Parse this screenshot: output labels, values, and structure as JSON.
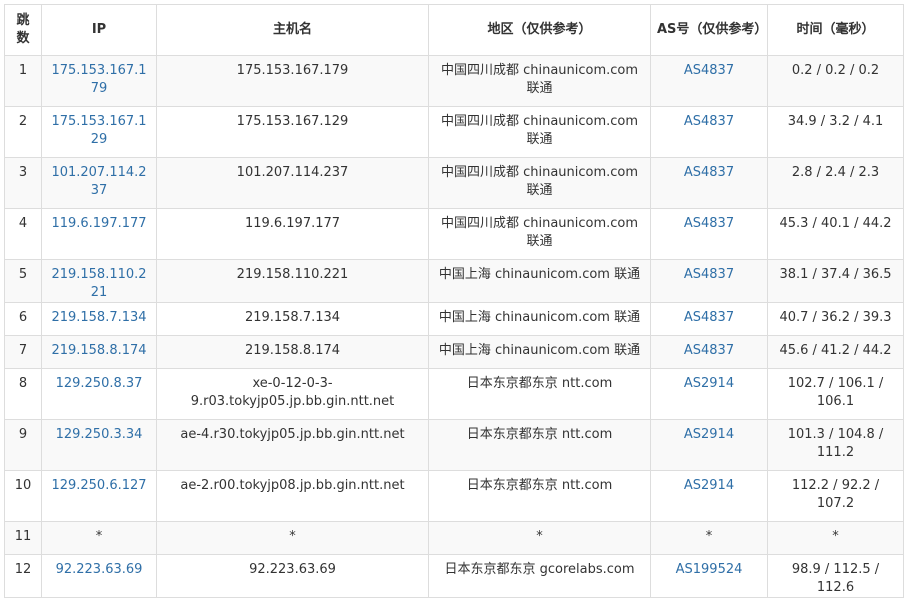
{
  "headers": {
    "hop": "跳数",
    "ip": "IP",
    "hostname": "主机名",
    "region": "地区（仅供参考）",
    "asn": "AS号（仅供参考）",
    "time": "时间（毫秒）"
  },
  "rows": [
    {
      "hop": "1",
      "ip": "175.153.167.179",
      "hostname": "175.153.167.179",
      "region": "中国四川成都 chinaunicom.com 联通",
      "asn": "AS4837",
      "time": "0.2 / 0.2 / 0.2"
    },
    {
      "hop": "2",
      "ip": "175.153.167.129",
      "hostname": "175.153.167.129",
      "region": "中国四川成都 chinaunicom.com 联通",
      "asn": "AS4837",
      "time": "34.9 / 3.2 / 4.1"
    },
    {
      "hop": "3",
      "ip": "101.207.114.237",
      "hostname": "101.207.114.237",
      "region": "中国四川成都 chinaunicom.com 联通",
      "asn": "AS4837",
      "time": "2.8 / 2.4 / 2.3"
    },
    {
      "hop": "4",
      "ip": "119.6.197.177",
      "hostname": "119.6.197.177",
      "region": "中国四川成都 chinaunicom.com 联通",
      "asn": "AS4837",
      "time": "45.3 / 40.1 / 44.2"
    },
    {
      "hop": "5",
      "ip": "219.158.110.221",
      "hostname": "219.158.110.221",
      "region": "中国上海 chinaunicom.com 联通",
      "asn": "AS4837",
      "time": "38.1 / 37.4 / 36.5"
    },
    {
      "hop": "6",
      "ip": "219.158.7.134",
      "hostname": "219.158.7.134",
      "region": "中国上海 chinaunicom.com 联通",
      "asn": "AS4837",
      "time": "40.7 / 36.2 / 39.3"
    },
    {
      "hop": "7",
      "ip": "219.158.8.174",
      "hostname": "219.158.8.174",
      "region": "中国上海 chinaunicom.com 联通",
      "asn": "AS4837",
      "time": "45.6 / 41.2 / 44.2"
    },
    {
      "hop": "8",
      "ip": "129.250.8.37",
      "hostname": "xe-0-12-0-3-9.r03.tokyjp05.jp.bb.gin.ntt.net",
      "region": "日本东京都东京 ntt.com",
      "asn": "AS2914",
      "time": "102.7 / 106.1 / 106.1"
    },
    {
      "hop": "9",
      "ip": "129.250.3.34",
      "hostname": "ae-4.r30.tokyjp05.jp.bb.gin.ntt.net",
      "region": "日本东京都东京 ntt.com",
      "asn": "AS2914",
      "time": "101.3 / 104.8 / 111.2"
    },
    {
      "hop": "10",
      "ip": "129.250.6.127",
      "hostname": "ae-2.r00.tokyjp08.jp.bb.gin.ntt.net",
      "region": "日本东京都东京 ntt.com",
      "asn": "AS2914",
      "time": "112.2 / 92.2 / 107.2"
    },
    {
      "hop": "11",
      "ip": "*",
      "hostname": "*",
      "region": "*",
      "asn": "*",
      "time": "*"
    },
    {
      "hop": "12",
      "ip": "92.223.63.69",
      "hostname": "92.223.63.69",
      "region": "日本东京都东京 gcorelabs.com",
      "asn": "AS199524",
      "time": "98.9 / 112.5 / 112.6"
    }
  ],
  "colors": {
    "link": "#2f6fa7",
    "text": "#333333",
    "border": "#dddddd",
    "stripe": "#f9f9f9"
  }
}
